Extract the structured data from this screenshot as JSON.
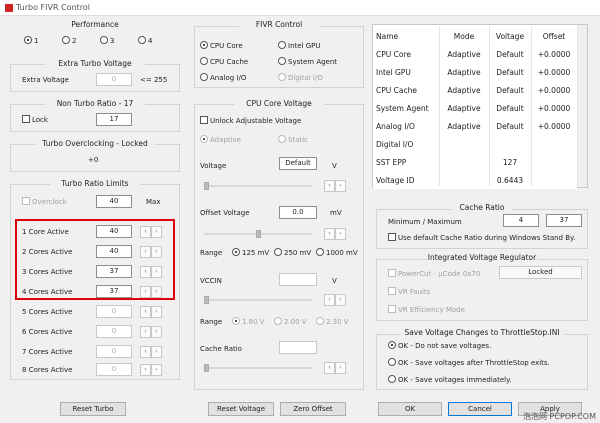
{
  "window": {
    "title": "Turbo FIVR Control"
  },
  "performance": {
    "title": "Performance",
    "options": [
      "1",
      "2",
      "3",
      "4"
    ],
    "selected": "1"
  },
  "extra_turbo": {
    "title": "Extra Turbo Voltage",
    "label": "Extra Voltage",
    "value": "0",
    "suffix": "<= 255"
  },
  "non_turbo": {
    "title": "Non Turbo Ratio - 17",
    "lock_label": "Lock",
    "value": "17"
  },
  "turbo_oc": {
    "title": "Turbo Overclocking - Locked",
    "value": "+0"
  },
  "turbo_ratio": {
    "title": "Turbo Ratio Limits",
    "overclock_label": "Overclock",
    "overclock_value": "40",
    "max_label": "Max",
    "rows": [
      {
        "label": "1 Core Active",
        "value": "40"
      },
      {
        "label": "2 Cores Active",
        "value": "40"
      },
      {
        "label": "3 Cores Active",
        "value": "37"
      },
      {
        "label": "4 Cores Active",
        "value": "37"
      },
      {
        "label": "5 Cores Active",
        "value": "0"
      },
      {
        "label": "6 Cores Active",
        "value": "0"
      },
      {
        "label": "7 Cores Active",
        "value": "0"
      },
      {
        "label": "8 Cores Active",
        "value": "0"
      }
    ],
    "reset_label": "Reset Turbo"
  },
  "fivr": {
    "title": "FIVR Control",
    "options": [
      "CPU Core",
      "Intel GPU",
      "CPU Cache",
      "System Agent",
      "Analog I/O",
      "Digital I/O"
    ],
    "selected": "CPU Core"
  },
  "core_voltage": {
    "title": "CPU Core Voltage",
    "unlock_label": "Unlock Adjustable Voltage",
    "adaptive_label": "Adaptive",
    "static_label": "Static",
    "voltage_label": "Voltage",
    "voltage_value": "Default",
    "voltage_unit": "V",
    "offset_label": "Offset Voltage",
    "offset_value": "0.0",
    "offset_unit": "mV",
    "range_label": "Range",
    "range_options": [
      "125 mV",
      "250 mV",
      "1000 mV"
    ],
    "vccin_label": "VCCIN",
    "vccin_unit": "V",
    "vccin_range_options": [
      "1.80 V",
      "2.00 V",
      "2.30 V"
    ],
    "cache_ratio_label": "Cache Ratio",
    "reset_voltage_label": "Reset Voltage",
    "zero_offset_label": "Zero Offset"
  },
  "status_table": {
    "headers": [
      "Name",
      "Mode",
      "Voltage",
      "Offset"
    ],
    "rows": [
      [
        "CPU Core",
        "Adaptive",
        "Default",
        "+0.0000"
      ],
      [
        "Intel GPU",
        "Adaptive",
        "Default",
        "+0.0000"
      ],
      [
        "CPU Cache",
        "Adaptive",
        "Default",
        "+0.0000"
      ],
      [
        "System Agent",
        "Adaptive",
        "Default",
        "+0.0000"
      ],
      [
        "Analog I/O",
        "Adaptive",
        "Default",
        "+0.0000"
      ],
      [
        "Digital I/O",
        "",
        "",
        ""
      ],
      [
        "SST EPP",
        "",
        "127",
        ""
      ],
      [
        "Voltage ID",
        "",
        "0.6443",
        ""
      ]
    ]
  },
  "cache_ratio": {
    "title": "Cache Ratio",
    "label": "Minimum / Maximum",
    "min": "4",
    "max": "37",
    "standby_label": "Use default Cache Ratio during Windows Stand By."
  },
  "ivr": {
    "title": "Integrated Voltage Regulator",
    "powercut_label": "PowerCut  -  µCode 0x70",
    "powercut_value": "Locked",
    "vr_faults_label": "VR Faults",
    "vr_efficiency_label": "VR Efficiency Mode"
  },
  "save_voltage": {
    "title": "Save Voltage Changes to ThrottleStop.INI",
    "options": [
      "OK - Do not save voltages.",
      "OK - Save voltages after ThrottleStop exits.",
      "OK - Save voltages immediately."
    ],
    "selected": "OK - Do not save voltages."
  },
  "dialog": {
    "ok_label": "OK",
    "cancel_label": "Cancel",
    "apply_label": "Apply"
  },
  "watermark": "泡泡网 PCPOP.COM"
}
